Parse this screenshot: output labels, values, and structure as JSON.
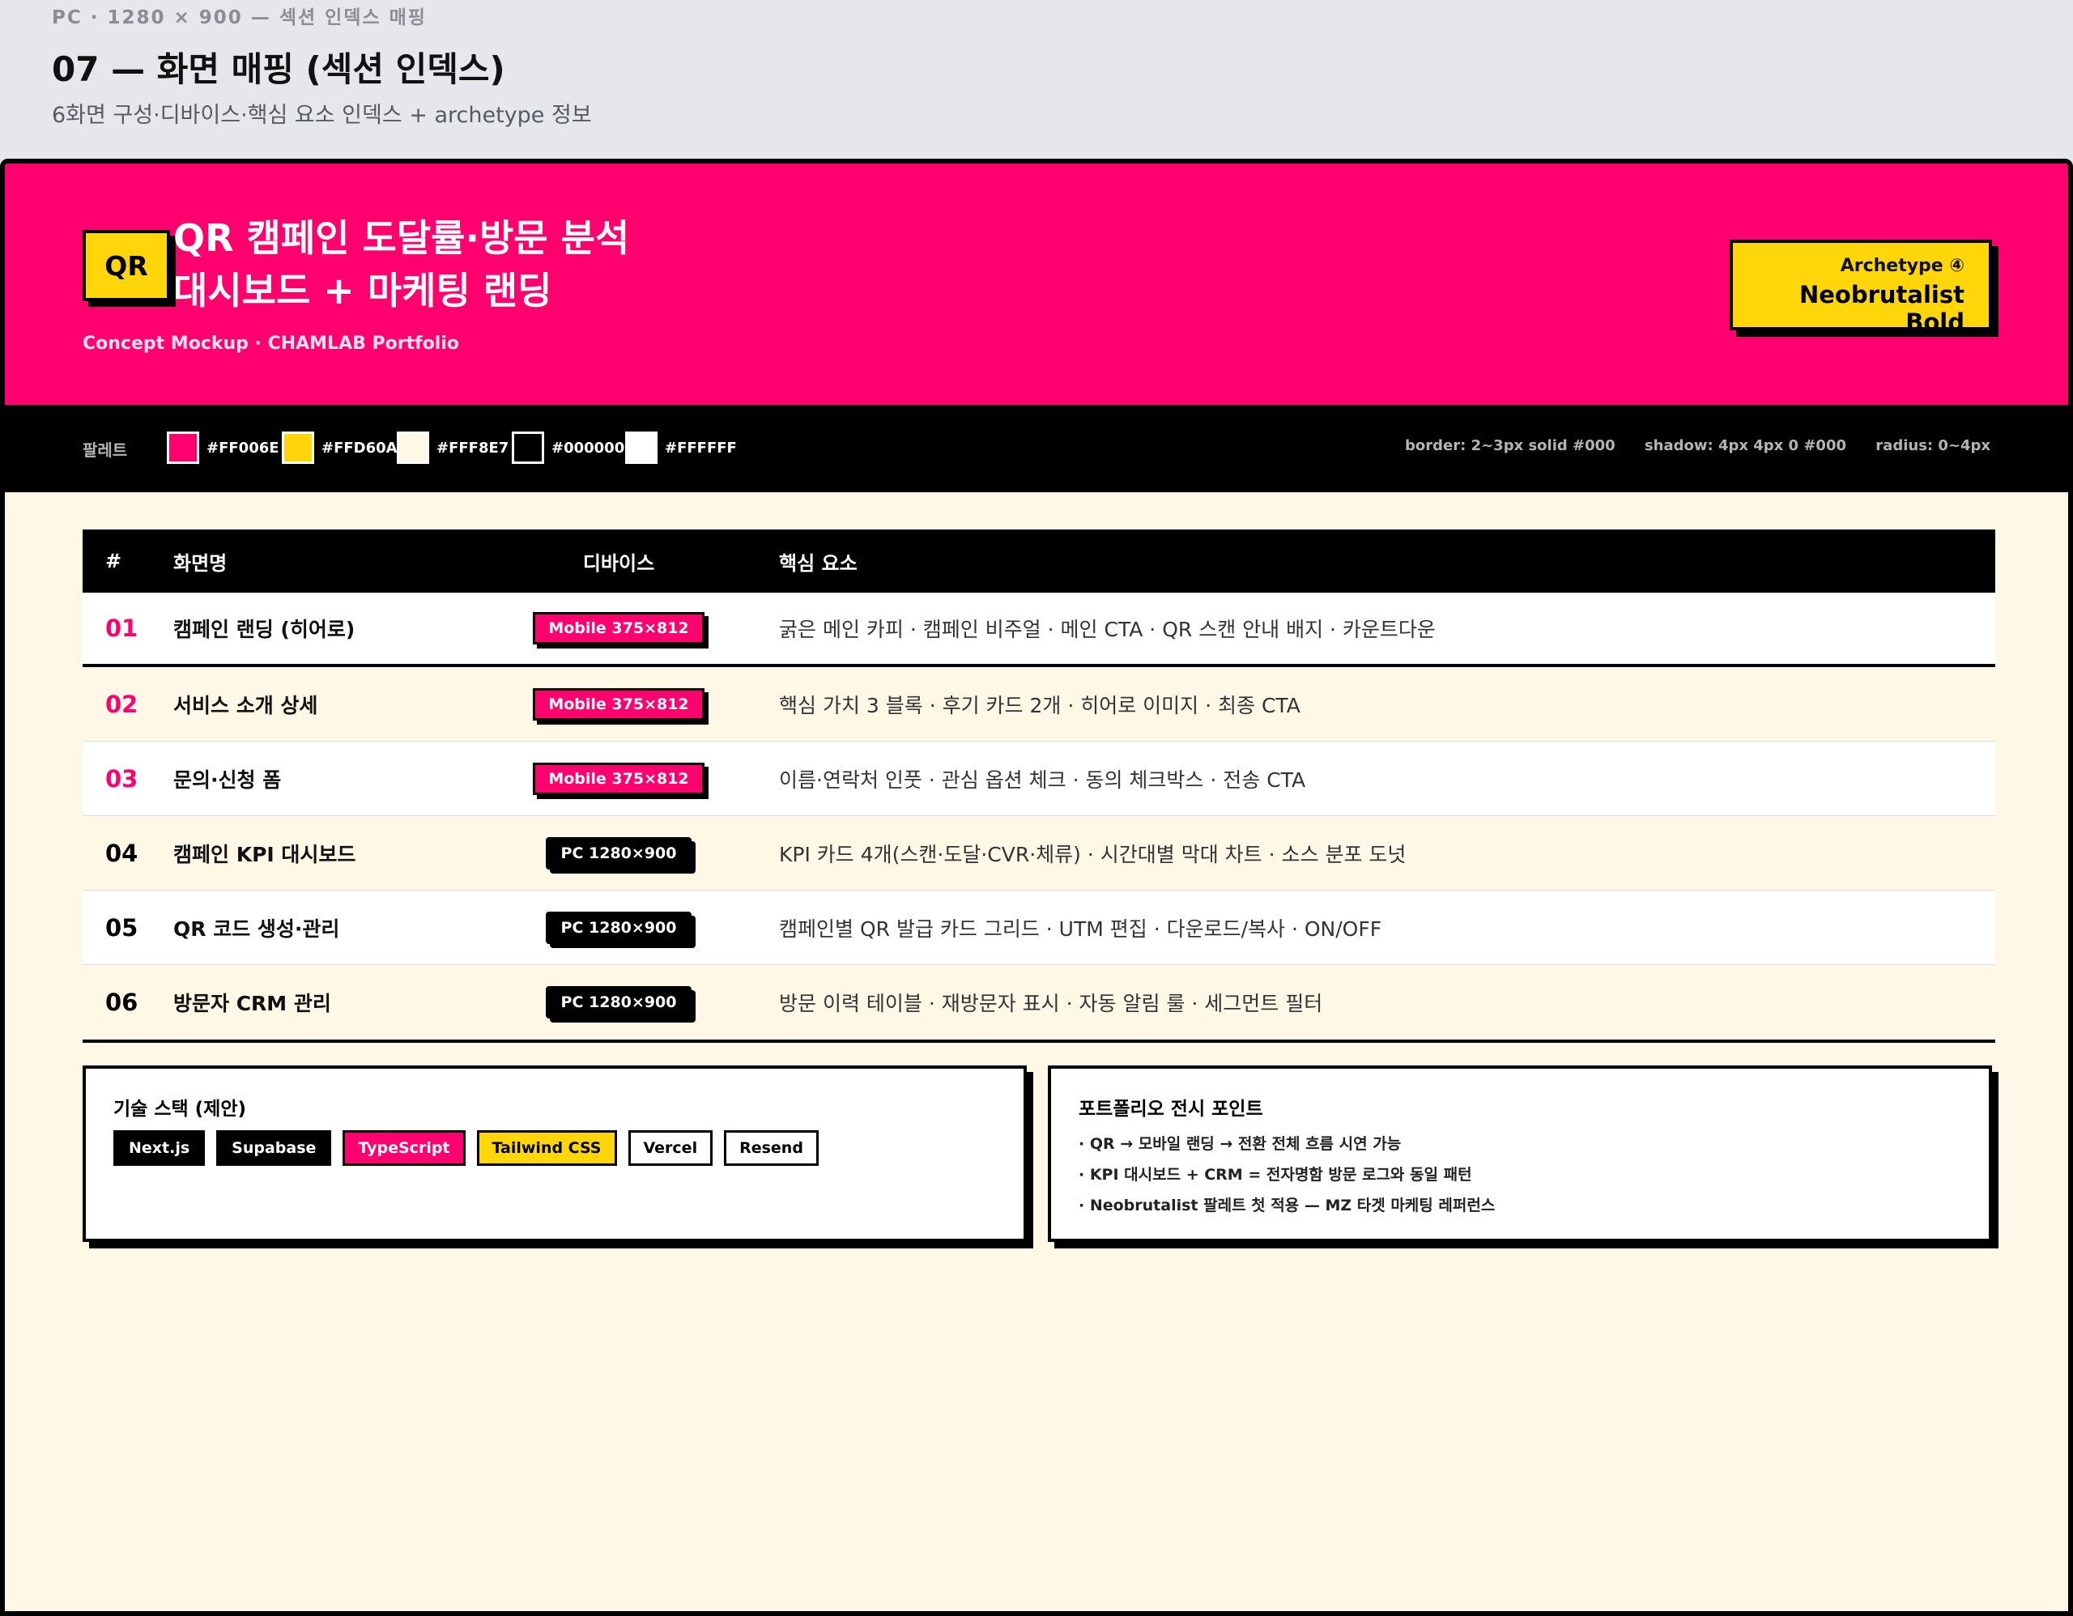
{
  "page": {
    "meta": "PC · 1280 × 900 — 섹션 인덱스 매핑",
    "title": "07 — 화면 매핑 (섹션 인덱스)",
    "subtitle": "6화면 구성·디바이스·핵심 요소 인덱스 + archetype 정보"
  },
  "hero": {
    "badge": "QR",
    "title_line1": "QR 캠페인 도달률·방문 분석",
    "title_line2": "대시보드 + 마케팅 랜딩",
    "caption": "Concept Mockup · CHAMLAB Portfolio",
    "archetype_label": "Archetype ④",
    "archetype_name": "Neobrutalist Bold"
  },
  "palette": {
    "label": "팔레트",
    "swatches": [
      {
        "hex": "#FF006E",
        "color": "#ff006e"
      },
      {
        "hex": "#FFD60A",
        "color": "#ffd60a"
      },
      {
        "hex": "#FFF8E7",
        "color": "#fff8e7"
      },
      {
        "hex": "#000000",
        "color": "#000000"
      },
      {
        "hex": "#FFFFFF",
        "color": "#ffffff"
      }
    ],
    "specs": [
      "border: 2~3px solid #000",
      "shadow: 4px 4px 0 #000",
      "radius: 0~4px"
    ]
  },
  "table": {
    "headers": {
      "num": "#",
      "name": "화면명",
      "device": "디바이스",
      "keys": "핵심 요소"
    },
    "rows": [
      {
        "num": "01",
        "name": "캠페인 랜딩 (히어로)",
        "device": "Mobile 375×812",
        "keys": "굵은 메인 카피 · 캠페인 비주얼 · 메인 CTA · QR 스캔 안내 배지 · 카운트다운"
      },
      {
        "num": "02",
        "name": "서비스 소개 상세",
        "device": "Mobile 375×812",
        "keys": "핵심 가치 3 블록 · 후기 카드 2개 · 히어로 이미지 · 최종 CTA"
      },
      {
        "num": "03",
        "name": "문의·신청 폼",
        "device": "Mobile 375×812",
        "keys": "이름·연락처 인풋 · 관심 옵션 체크 · 동의 체크박스 · 전송 CTA"
      },
      {
        "num": "04",
        "name": "캠페인 KPI 대시보드",
        "device": "PC 1280×900",
        "keys": "KPI 카드 4개(스캔·도달·CVR·체류) · 시간대별 막대 차트 · 소스 분포 도넛"
      },
      {
        "num": "05",
        "name": "QR 코드 생성·관리",
        "device": "PC 1280×900",
        "keys": "캠페인별 QR 발급 카드 그리드 · UTM 편집 · 다운로드/복사 · ON/OFF"
      },
      {
        "num": "06",
        "name": "방문자 CRM 관리",
        "device": "PC 1280×900",
        "keys": "방문 이력 테이블 · 재방문자 표시 · 자동 알림 룰 · 세그먼트 필터"
      }
    ]
  },
  "tech": {
    "title": "기술 스택 (제안)",
    "chips": [
      "Next.js",
      "Supabase",
      "TypeScript",
      "Tailwind CSS",
      "Vercel",
      "Resend"
    ]
  },
  "points": {
    "title": "포트폴리오 전시 포인트",
    "items": [
      "· QR → 모바일 랜딩 → 전환 전체 흐름 시연 가능",
      "· KPI 대시보드 + CRM = 전자명함 방문 로그와 동일 패턴",
      "· Neobrutalist 팔레트 첫 적용 — MZ 타겟 마케팅 레퍼런스"
    ]
  }
}
